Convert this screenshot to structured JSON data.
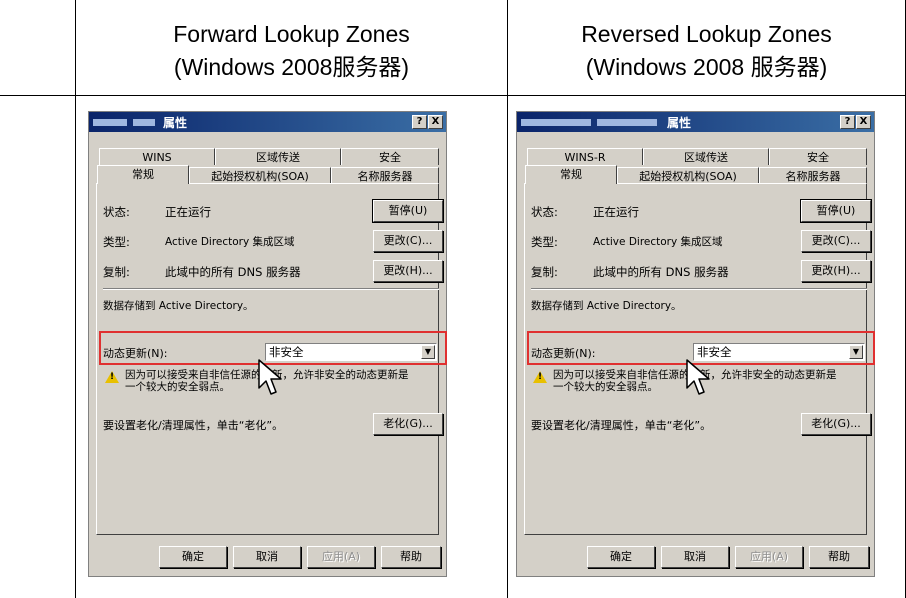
{
  "columns": [
    {
      "heading_line1": "Forward Lookup Zones",
      "heading_line2": "(Windows 2008服务器)",
      "dialog": {
        "title": "属性",
        "help_btn": "?",
        "close_btn": "X",
        "tabs_row1": [
          "WINS",
          "区域传送",
          "安全"
        ],
        "tabs_row2": [
          "常规",
          "起始授权机构(SOA)",
          "名称服务器"
        ],
        "status_label": "状态:",
        "status_value": "正在运行",
        "pause_btn": "暂停(U)",
        "type_label": "类型:",
        "type_value": "Active Directory 集成区域",
        "change_type_btn": "更改(C)...",
        "repl_label": "复制:",
        "repl_value": "此域中的所有 DNS 服务器",
        "change_repl_btn": "更改(H)...",
        "storage_text": "数据存储到 Active Directory。",
        "dynamic_update_label": "动态更新(N):",
        "dynamic_update_value": "非安全",
        "warning_line1": "因为可以接受来自非信任源的更新，允许非安全的动态更新是",
        "warning_line2": "一个较大的安全弱点。",
        "aging_text": "要设置老化/清理属性，单击“老化”。",
        "aging_btn": "老化(G)...",
        "ok_btn": "确定",
        "cancel_btn": "取消",
        "apply_btn": "应用(A)",
        "help_bottom_btn": "帮助"
      }
    },
    {
      "heading_line1": "Reversed Lookup Zones",
      "heading_line2": "(Windows 2008 服务器)",
      "dialog": {
        "title": "属性",
        "help_btn": "?",
        "close_btn": "X",
        "tabs_row1": [
          "WINS-R",
          "区域传送",
          "安全"
        ],
        "tabs_row2": [
          "常规",
          "起始授权机构(SOA)",
          "名称服务器"
        ],
        "status_label": "状态:",
        "status_value": "正在运行",
        "pause_btn": "暂停(U)",
        "type_label": "类型:",
        "type_value": "Active Directory 集成区域",
        "change_type_btn": "更改(C)...",
        "repl_label": "复制:",
        "repl_value": "此域中的所有 DNS 服务器",
        "change_repl_btn": "更改(H)...",
        "storage_text": "数据存储到 Active Directory。",
        "dynamic_update_label": "动态更新(N):",
        "dynamic_update_value": "非安全",
        "warning_line1": "因为可以接受来自非信任源的更新，允许非安全的动态更新是",
        "warning_line2": "一个较大的安全弱点。",
        "aging_text": "要设置老化/清理属性，单击“老化”。",
        "aging_btn": "老化(G)...",
        "ok_btn": "确定",
        "cancel_btn": "取消",
        "apply_btn": "应用(A)",
        "help_bottom_btn": "帮助"
      }
    }
  ],
  "colors": {
    "highlight": "#e03030",
    "title_bar": "#0a246a",
    "dialog_bg": "#d4d0c8"
  },
  "icons": [
    "warning-icon",
    "mouse-cursor-icon"
  ]
}
